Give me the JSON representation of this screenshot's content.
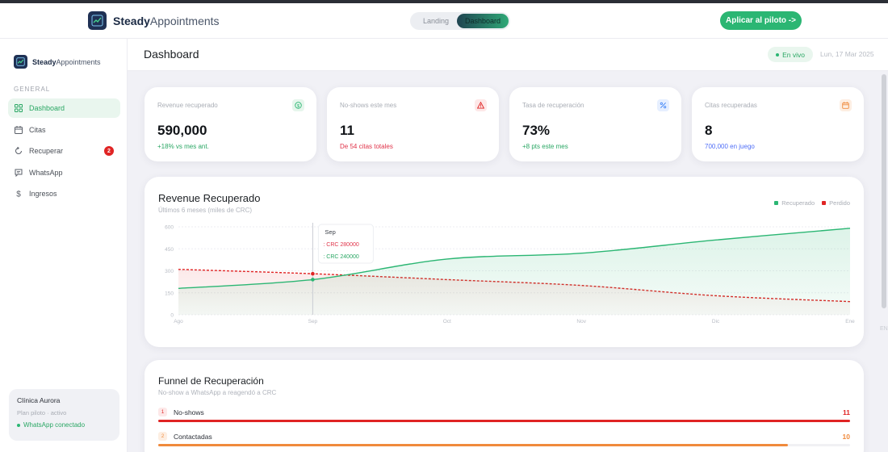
{
  "brand": {
    "name_bold": "Steady",
    "name_light": "Appointments"
  },
  "view_toggle": {
    "options": [
      "Landing",
      "Dashboard"
    ],
    "active": "Dashboard"
  },
  "header_cta": {
    "label": "Aplicar al piloto ->"
  },
  "sidebar": {
    "section_label": "GENERAL",
    "items": [
      {
        "label": "Dashboard",
        "icon": "grid-icon",
        "active": true
      },
      {
        "label": "Citas",
        "icon": "calendar-icon"
      },
      {
        "label": "Recuperar",
        "icon": "refresh-icon",
        "badge": "2"
      },
      {
        "label": "WhatsApp",
        "icon": "message-icon"
      },
      {
        "label": "Ingresos",
        "icon": "dollar-icon"
      }
    ],
    "clinic": {
      "name": "Clínica Aurora",
      "plan": "Plan piloto · activo",
      "status": "WhatsApp conectado"
    }
  },
  "page": {
    "title": "Dashboard",
    "live_label": "En vivo",
    "date": "Lun, 17 Mar 2025"
  },
  "kpis": [
    {
      "label": "Revenue recuperado",
      "value": "590,000",
      "sub": "+18% vs mes ant.",
      "icon": "dollar-circle-icon",
      "accent": "#2bb673",
      "sub_color": "#2aa764"
    },
    {
      "label": "No-shows este mes",
      "value": "11",
      "sub": "De 54 citas totales",
      "icon": "alert-icon",
      "accent": "#e02424",
      "sub_color": "#e0344a"
    },
    {
      "label": "Tasa de recuperación",
      "value": "73%",
      "sub": "+8 pts este mes",
      "icon": "percent-icon",
      "accent": "#3b82f6",
      "sub_color": "#2aa764"
    },
    {
      "label": "Citas recuperadas",
      "value": "8",
      "sub": "700,000 en juego",
      "icon": "calendar-icon",
      "accent": "#f08a3c",
      "sub_color": "#4f6ef7"
    }
  ],
  "chart_data": {
    "type": "area",
    "title": "Revenue Recuperado",
    "subtitle": "Últimos 6 meses (miles de CRC)",
    "categories": [
      "Ago",
      "Sep",
      "Oct",
      "Nov",
      "Dic",
      "Ene"
    ],
    "ylim": [
      0,
      600
    ],
    "yticks": [
      0,
      150,
      300,
      450,
      600
    ],
    "series": [
      {
        "name": "Recuperado",
        "values": [
          180,
          240,
          380,
          420,
          510,
          590
        ],
        "color": "#2bb673",
        "style": "solid"
      },
      {
        "name": "Perdido",
        "values": [
          310,
          280,
          240,
          200,
          130,
          90
        ],
        "color": "#e02424",
        "style": "dashed"
      }
    ],
    "grid": true,
    "legend": "top-right",
    "tooltip": {
      "category": "Sep",
      "perdido": ": CRC 280000",
      "recuperado": ": CRC 240000"
    }
  },
  "funnel": {
    "title": "Funnel de Recuperación",
    "subtitle": "No-show a WhatsApp a reagendó a CRC",
    "rows": [
      {
        "num": "1",
        "label": "No-shows",
        "count": "11",
        "pct": 1.0,
        "color": "#e02424"
      },
      {
        "num": "2",
        "label": "Contactadas",
        "count": "10",
        "pct": 0.91,
        "color": "#f08a3c"
      }
    ]
  },
  "edge_label": "EN"
}
